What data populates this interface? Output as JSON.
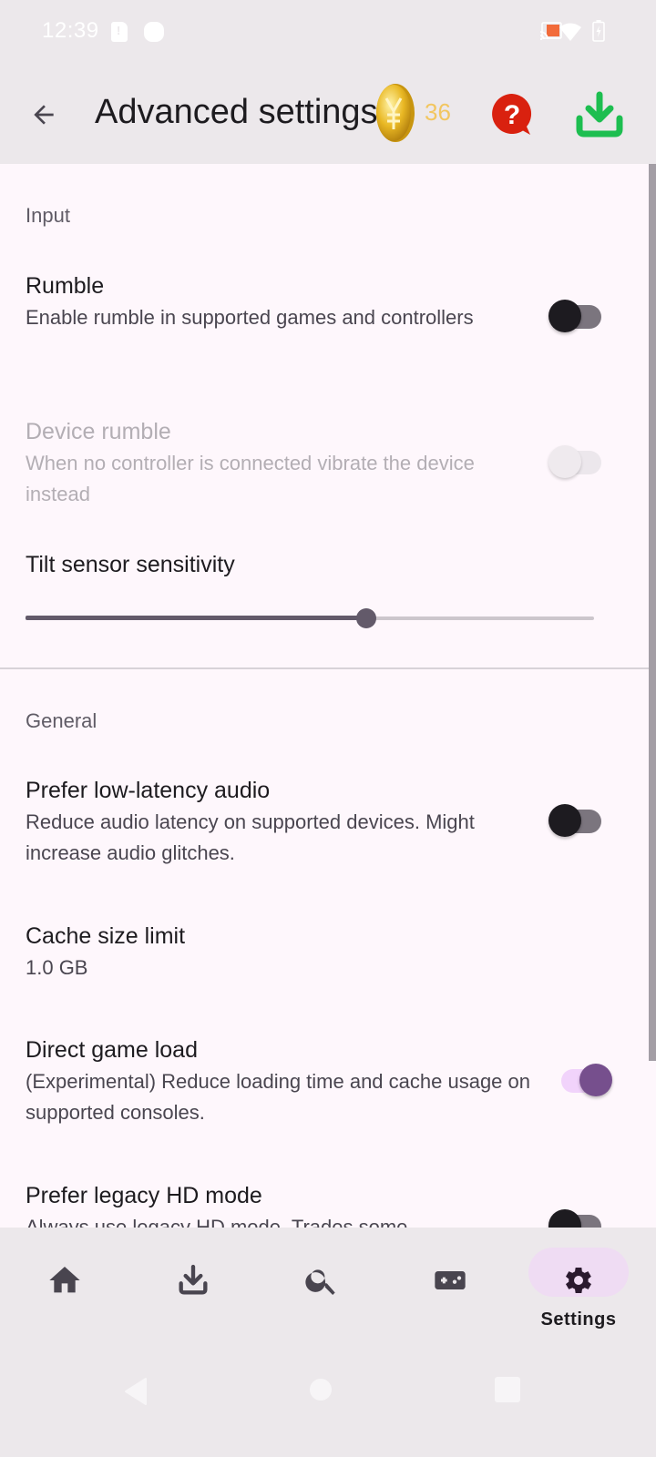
{
  "status_bar": {
    "time": "12:39",
    "left_icons": [
      "sim-alert-icon",
      "notification-dot-icon"
    ],
    "right_icons": [
      "cast-icon",
      "wifi-icon",
      "battery-charging-icon"
    ],
    "cast_color": "#f26b3a"
  },
  "app_bar": {
    "back_icon": "arrow-left-icon",
    "title": "Advanced settings",
    "coin_icon": "gold-coin-icon",
    "coin_count": "36",
    "coin_count_color": "#f2c660",
    "help_icon": "help-bubble-icon",
    "help_color": "#d9210f",
    "download_icon": "download-icon",
    "download_color": "#1dbe50"
  },
  "sections": [
    {
      "header": "Input",
      "items": [
        {
          "title": "Rumble",
          "summary": "Enable rumble in supported games and controllers",
          "type": "switch",
          "checked": false,
          "enabled": true
        },
        {
          "title": "Device rumble",
          "summary": "When no controller is connected vibrate the device instead",
          "type": "switch",
          "checked": false,
          "enabled": false
        },
        {
          "title": "Tilt sensor sensitivity",
          "type": "slider",
          "value_fraction": 0.6
        }
      ]
    },
    {
      "header": "General",
      "items": [
        {
          "title": "Prefer low-latency audio",
          "summary": "Reduce audio latency on supported devices. Might increase audio glitches.",
          "type": "switch",
          "checked": false,
          "enabled": true
        },
        {
          "title": "Cache size limit",
          "summary": "1.0 GB",
          "type": "value"
        },
        {
          "title": "Direct game load",
          "summary": "(Experimental) Reduce loading time and cache usage on supported consoles.",
          "type": "switch",
          "checked": true,
          "enabled": true
        },
        {
          "title": "Prefer legacy HD mode",
          "summary": "Always use legacy HD mode. Trades some",
          "type": "switch",
          "checked": false,
          "enabled": true
        }
      ]
    }
  ],
  "accent_color": "#764f8d",
  "bottom_nav": {
    "items": [
      {
        "icon": "home-icon",
        "label": ""
      },
      {
        "icon": "download-tray-icon",
        "label": ""
      },
      {
        "icon": "search-icon",
        "label": ""
      },
      {
        "icon": "gamepad-icon",
        "label": ""
      },
      {
        "icon": "gear-icon",
        "label": "Settings",
        "active": true
      }
    ]
  },
  "system_nav": {
    "buttons": [
      "back-triangle-icon",
      "home-circle-icon",
      "recents-square-icon"
    ]
  }
}
